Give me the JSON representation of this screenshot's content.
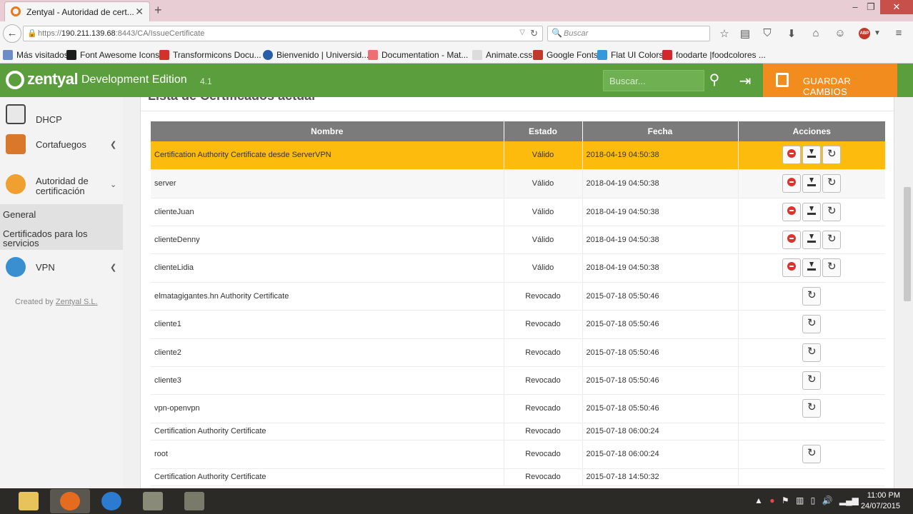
{
  "browser": {
    "tab_title": "Zentyal - Autoridad de cert...",
    "tab_close": "✕",
    "new_tab": "+",
    "url_scheme": "https://",
    "url_host": "190.211.139.68",
    "url_rest": ":8443/CA/IssueCertificate",
    "search_placeholder": "Buscar",
    "bookmarks": [
      "Más visitados",
      "Font Awesome Icons",
      "Transformicons Docu...",
      "Bienvenido | Universid...",
      "Documentation - Mat...",
      "Animate.css",
      "Google Fonts",
      "Flat UI Colors",
      "foodarte |foodcolores ..."
    ]
  },
  "app": {
    "logo": "zentyal",
    "edition": "Development Edition",
    "version": "4.1",
    "search_placeholder": "Buscar...",
    "save_label": "GUARDAR CAMBIOS"
  },
  "sidebar": {
    "items": [
      {
        "label": "DHCP"
      },
      {
        "label": "Cortafuegos"
      },
      {
        "label_line1": "Autoridad de",
        "label_line2": "certificación"
      },
      {
        "label": "VPN"
      }
    ],
    "submenu": [
      {
        "label": "General"
      },
      {
        "label_line1": "Certificados para los",
        "label_line2": "servicios"
      }
    ],
    "credit_prefix": "Created by ",
    "credit_link": "Zentyal S.L."
  },
  "main": {
    "section_title": "Lista de Certificados actual",
    "columns": [
      "Nombre",
      "Estado",
      "Fecha",
      "Acciones"
    ],
    "rows": [
      {
        "name": "Certification Authority Certificate desde ServerVPN",
        "status": "Válido",
        "date": "2018-04-19 04:50:38"
      },
      {
        "name": "server",
        "status": "Válido",
        "date": "2018-04-19 04:50:38"
      },
      {
        "name": "clienteJuan",
        "status": "Válido",
        "date": "2018-04-19 04:50:38"
      },
      {
        "name": "clienteDenny",
        "status": "Válido",
        "date": "2018-04-19 04:50:38"
      },
      {
        "name": "clienteLidia",
        "status": "Válido",
        "date": "2018-04-19 04:50:38"
      },
      {
        "name": "elmatagigantes.hn Authority Certificate",
        "status": "Revocado",
        "date": "2015-07-18 05:50:46"
      },
      {
        "name": "cliente1",
        "status": "Revocado",
        "date": "2015-07-18 05:50:46"
      },
      {
        "name": "cliente2",
        "status": "Revocado",
        "date": "2015-07-18 05:50:46"
      },
      {
        "name": "cliente3",
        "status": "Revocado",
        "date": "2015-07-18 05:50:46"
      },
      {
        "name": "vpn-openvpn",
        "status": "Revocado",
        "date": "2015-07-18 05:50:46"
      },
      {
        "name": "Certification Authority Certificate",
        "status": "Revocado",
        "date": "2015-07-18 06:00:24"
      },
      {
        "name": "root",
        "status": "Revocado",
        "date": "2015-07-18 06:00:24"
      },
      {
        "name": "Certification Authority Certificate",
        "status": "Revocado",
        "date": "2015-07-18 14:50:32"
      }
    ]
  },
  "taskbar": {
    "time": "11:00 PM",
    "date": "24/07/2015"
  },
  "colors": {
    "header_green": "#5a9e3d",
    "save_orange": "#f28c1f",
    "highlight_row": "#fdbb0d",
    "table_header": "#7b7b7b",
    "revoke_red": "#d9352f"
  }
}
